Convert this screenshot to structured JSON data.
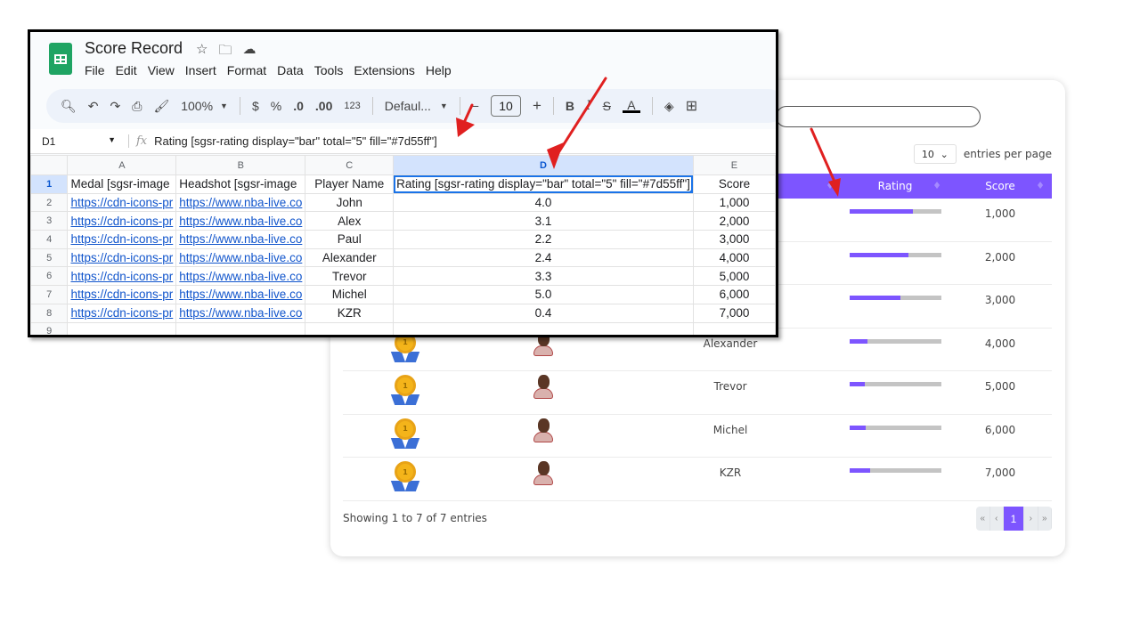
{
  "sheets": {
    "doc_title": "Score Record",
    "title_icons": [
      "star-icon",
      "move-to-folder-icon",
      "cloud-saved-icon"
    ],
    "menu": [
      "File",
      "Edit",
      "View",
      "Insert",
      "Format",
      "Data",
      "Tools",
      "Extensions",
      "Help"
    ],
    "toolbar": {
      "zoom": "100%",
      "currency": "$",
      "percent": "%",
      "decrease_decimal": ".0",
      "increase_decimal": ".00",
      "number_format": "123",
      "font": "Defaul...",
      "font_size": "10",
      "minus": "−",
      "plus": "+",
      "bold": "B",
      "italic": "I",
      "text_color": "A"
    },
    "name_box": "D1",
    "formula": "Rating [sgsr-rating display=\"bar\" total=\"5\" fill=\"#7d55ff\"]",
    "column_headers": [
      "A",
      "B",
      "C",
      "D",
      "E"
    ],
    "selected_column": "D",
    "row_numbers": [
      "1",
      "2",
      "3",
      "4",
      "5",
      "6",
      "7",
      "8",
      "9"
    ],
    "header_row": [
      "Medal [sgsr-image",
      "Headshot [sgsr-image",
      "Player Name",
      "Rating [sgsr-rating display=\"bar\" total=\"5\" fill=\"#7d55ff\"]",
      "Score"
    ],
    "rows": [
      {
        "medal": "https://cdn-icons-pr",
        "headshot": "https://www.nba-live.co",
        "name": "John",
        "rating": "4.0",
        "score": "1,000"
      },
      {
        "medal": "https://cdn-icons-pr",
        "headshot": "https://www.nba-live.co",
        "name": "Alex",
        "rating": "3.1",
        "score": "2,000"
      },
      {
        "medal": "https://cdn-icons-pr",
        "headshot": "https://www.nba-live.co",
        "name": "Paul",
        "rating": "2.2",
        "score": "3,000"
      },
      {
        "medal": "https://cdn-icons-pr",
        "headshot": "https://www.nba-live.co",
        "name": "Alexander",
        "rating": "2.4",
        "score": "4,000"
      },
      {
        "medal": "https://cdn-icons-pr",
        "headshot": "https://www.nba-live.co",
        "name": "Trevor",
        "rating": "3.3",
        "score": "5,000"
      },
      {
        "medal": "https://cdn-icons-pr",
        "headshot": "https://www.nba-live.co",
        "name": "Michel",
        "rating": "5.0",
        "score": "6,000"
      },
      {
        "medal": "https://cdn-icons-pr",
        "headshot": "https://www.nba-live.co",
        "name": "KZR",
        "rating": "0.4",
        "score": "7,000"
      }
    ]
  },
  "web_table": {
    "per_page_value": "10",
    "per_page_label": "entries per page",
    "headers": [
      "Rating",
      "Score"
    ],
    "accent_color": "#7d55ff",
    "track_color": "#c4c4c4",
    "medal_number": "1",
    "rows": [
      {
        "name": "",
        "rating_fill_fraction": 0.69,
        "score": "1,000"
      },
      {
        "name": "",
        "rating_fill_fraction": 0.65,
        "score": "2,000"
      },
      {
        "name": "",
        "rating_fill_fraction": 0.56,
        "score": "3,000"
      },
      {
        "name": "Alexander",
        "rating_fill_fraction": 0.2,
        "score": "4,000"
      },
      {
        "name": "Trevor",
        "rating_fill_fraction": 0.17,
        "score": "5,000"
      },
      {
        "name": "Michel",
        "rating_fill_fraction": 0.18,
        "score": "6,000"
      },
      {
        "name": "KZR",
        "rating_fill_fraction": 0.23,
        "score": "7,000"
      }
    ],
    "footer_text": "Showing 1 to 7 of 7 entries",
    "pager": {
      "first": "«",
      "prev": "‹",
      "current": "1",
      "next": "›",
      "last": "»"
    }
  },
  "annotation_color": "#e02020"
}
